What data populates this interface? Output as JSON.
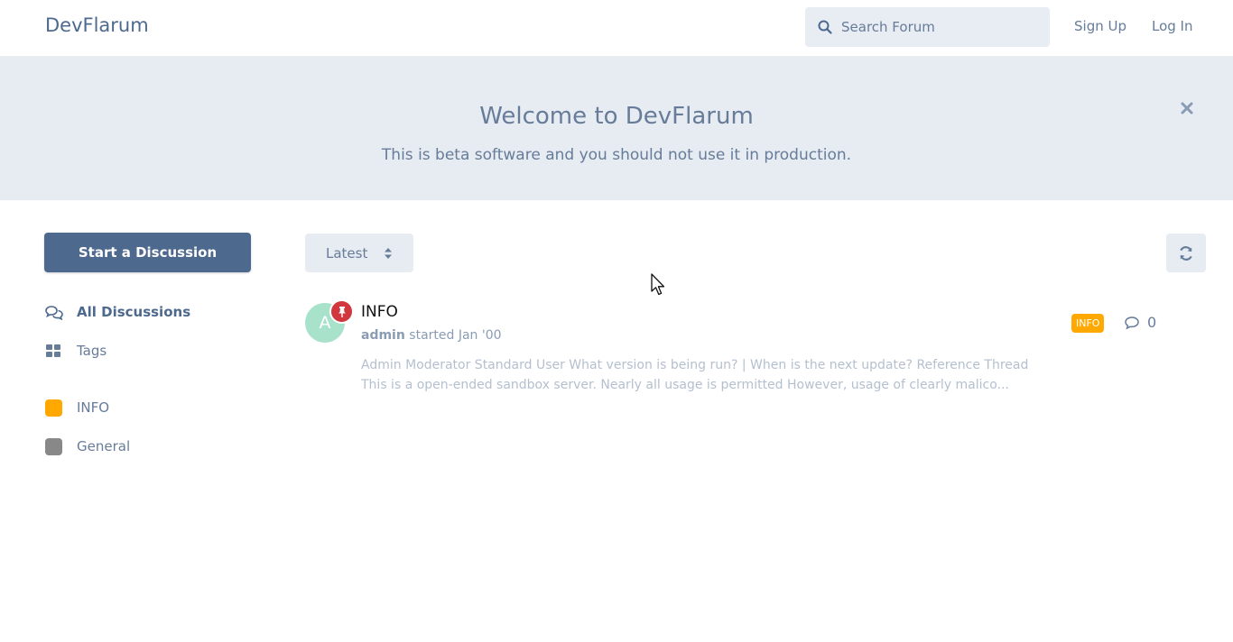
{
  "header": {
    "brand": "DevFlarum",
    "search_placeholder": "Search Forum",
    "signup_label": "Sign Up",
    "login_label": "Log In"
  },
  "hero": {
    "title": "Welcome to DevFlarum",
    "subtitle": "This is beta software and you should not use it in production."
  },
  "sidebar": {
    "start_discussion_label": "Start a Discussion",
    "nav": [
      {
        "label": "All Discussions",
        "icon": "comments-icon",
        "active": true
      },
      {
        "label": "Tags",
        "icon": "tags-grid-icon"
      }
    ],
    "tags": [
      {
        "label": "INFO",
        "color": "#ffa800"
      },
      {
        "label": "General",
        "color": "#888888"
      }
    ]
  },
  "toolbar": {
    "sort_selected": "Latest"
  },
  "discussions": [
    {
      "avatar_letter": "A",
      "avatar_color": "#a8e2cb",
      "pinned": true,
      "title": "INFO",
      "author": "admin",
      "started_text": "started Jan '00",
      "excerpt": "Admin Moderator Standard User What version is being run? | When is the next update? Reference Thread This is a open-ended sandbox server. Nearly all usage is permitted However, usage of clearly malico...",
      "tag": "INFO",
      "tag_color": "#ffa800",
      "reply_count": "0"
    }
  ],
  "colors": {
    "primary": "#4d698e",
    "hero_bg": "#e7ebf2",
    "muted_text": "#667c99",
    "pin_red": "#d0383d"
  }
}
